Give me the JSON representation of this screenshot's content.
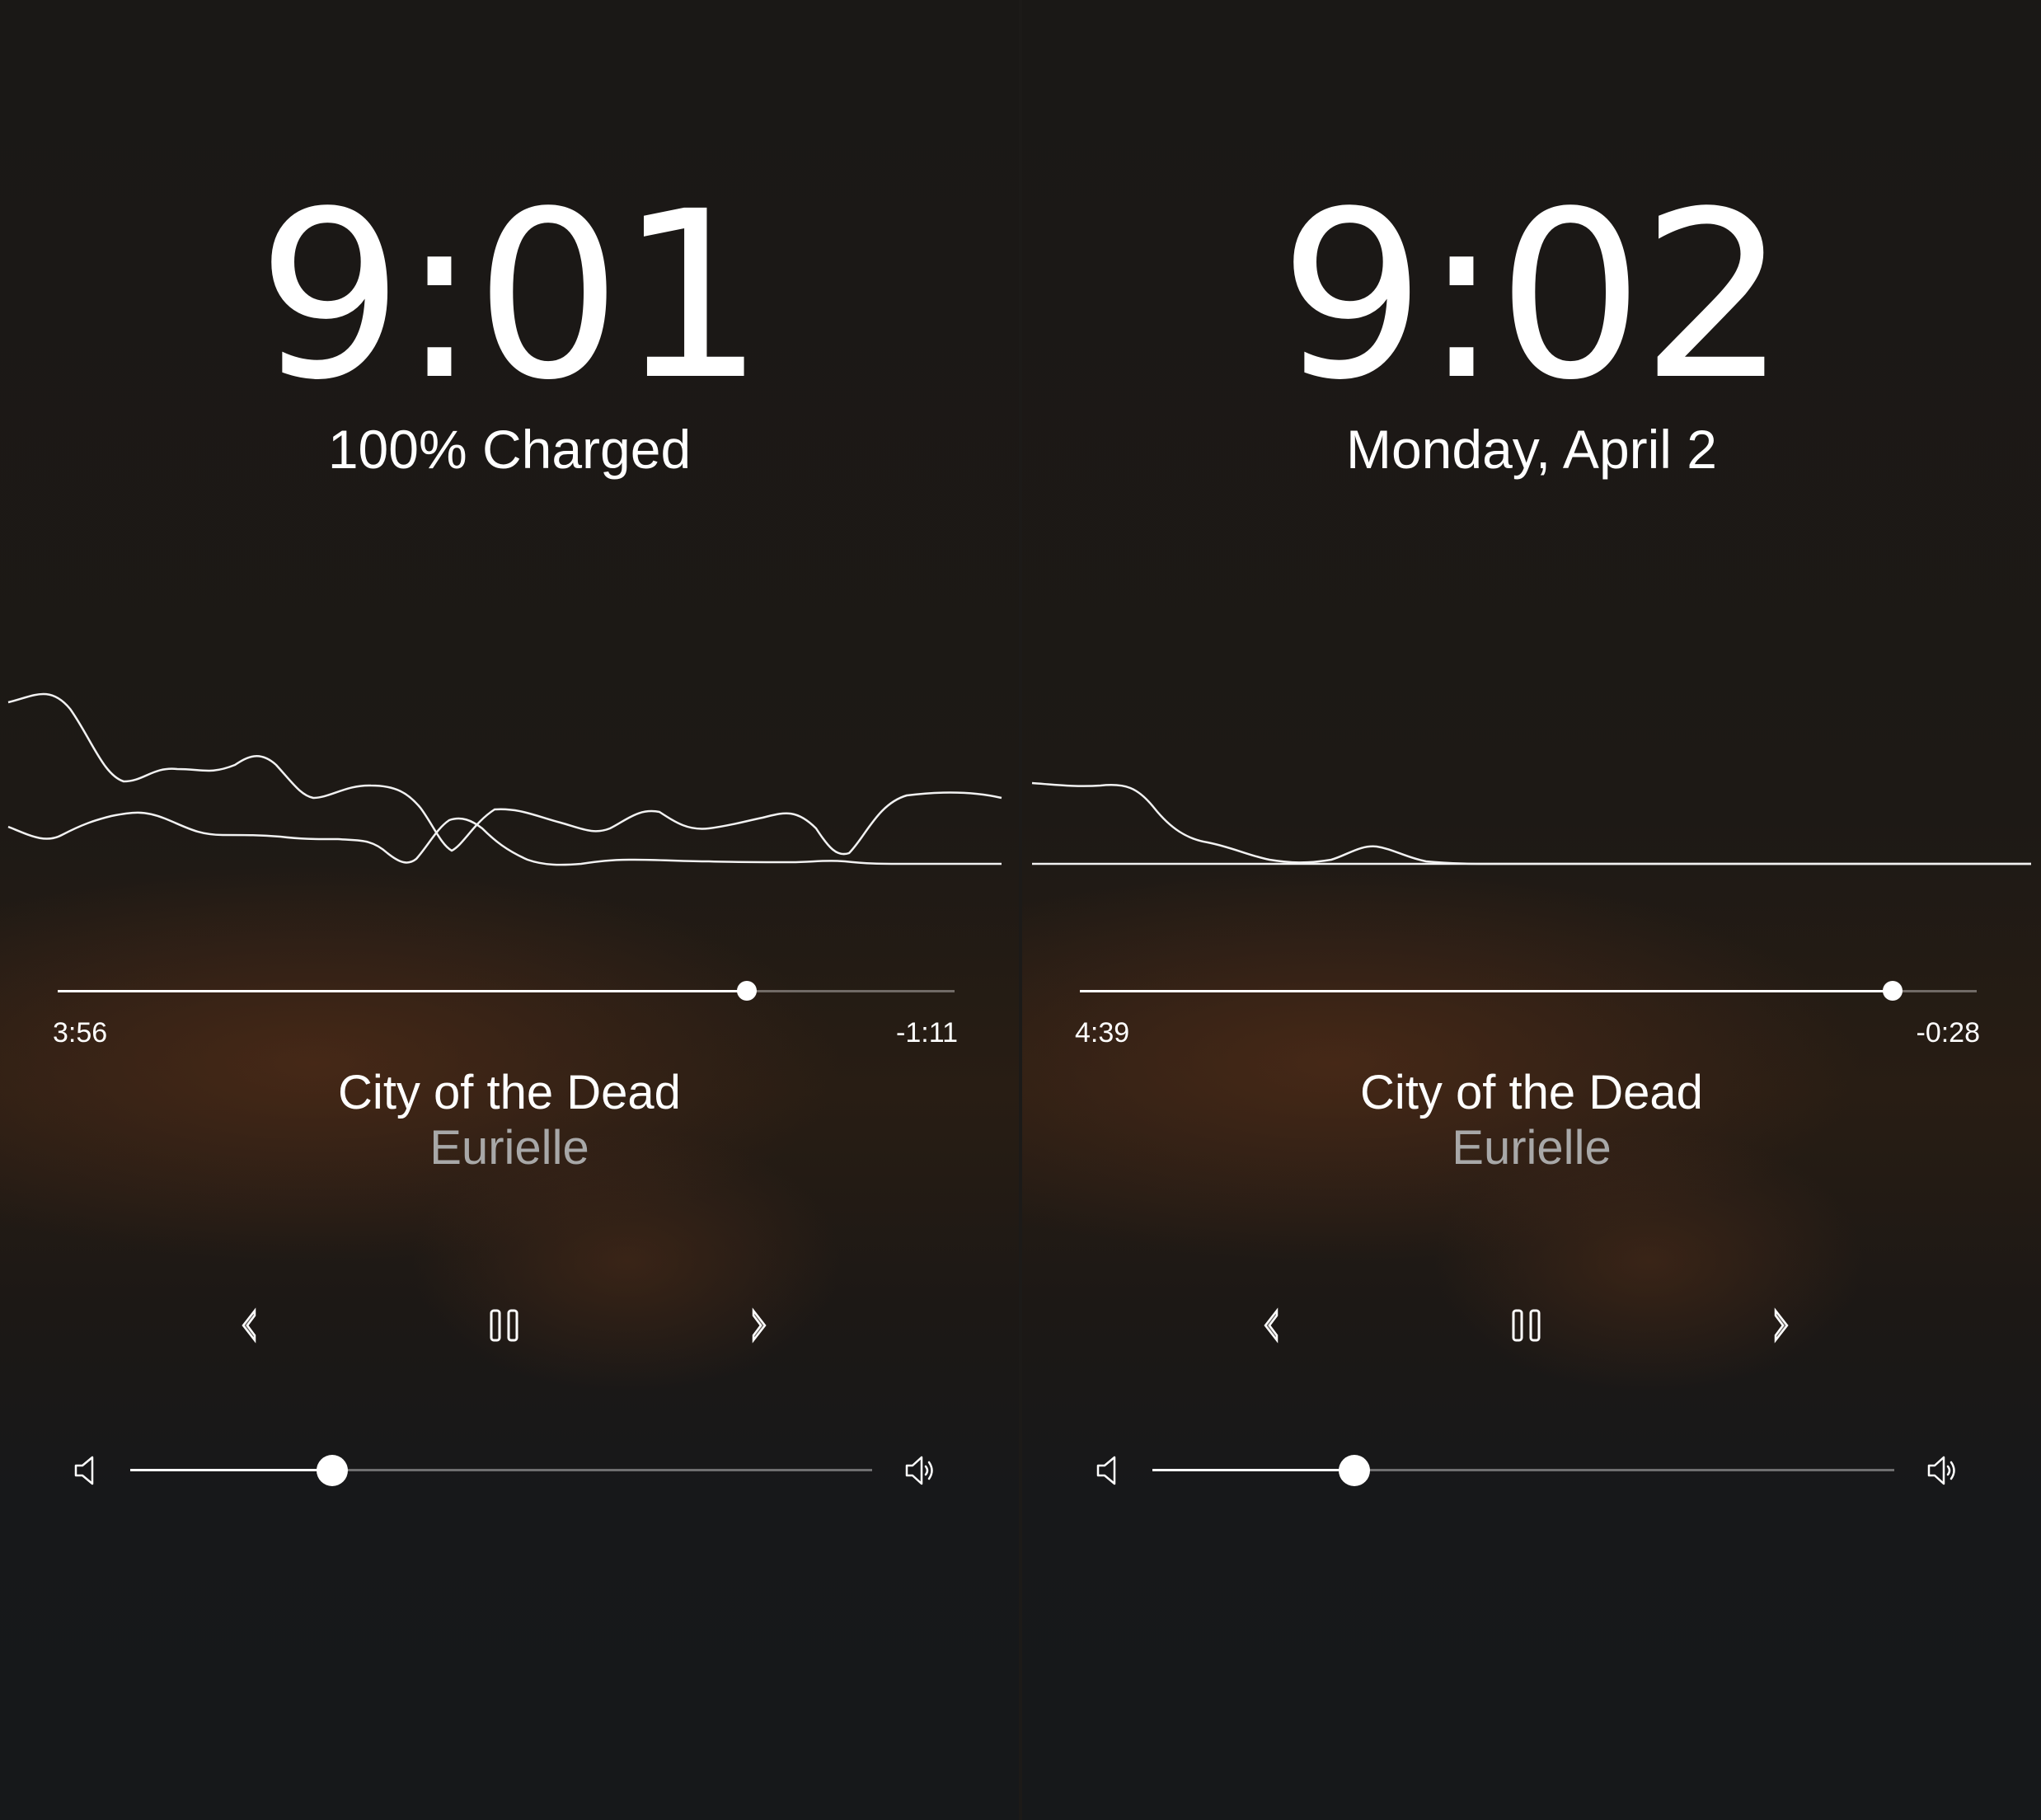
{
  "screens": [
    {
      "clock": "9:01",
      "subline": "100% Charged",
      "track": {
        "title": "City of the Dead",
        "artist": "Eurielle"
      },
      "progress": {
        "elapsed": "3:56",
        "remaining": "-1:11",
        "fraction": 0.768
      },
      "volume": {
        "level": 0.272
      }
    },
    {
      "clock": "9:02",
      "subline": "Monday, April 2",
      "track": {
        "title": "City of the Dead",
        "artist": "Eurielle"
      },
      "progress": {
        "elapsed": "4:39",
        "remaining": "-0:28",
        "fraction": 0.906
      },
      "volume": {
        "level": 0.272
      }
    }
  ],
  "icons": {
    "previous": "chevron-left-icon",
    "pause": "pause-icon",
    "next": "chevron-right-icon",
    "volume_min": "speaker-low-icon",
    "volume_max": "speaker-high-icon"
  },
  "colors": {
    "text_primary": "#ffffff",
    "text_secondary": "#a8a8a8"
  }
}
